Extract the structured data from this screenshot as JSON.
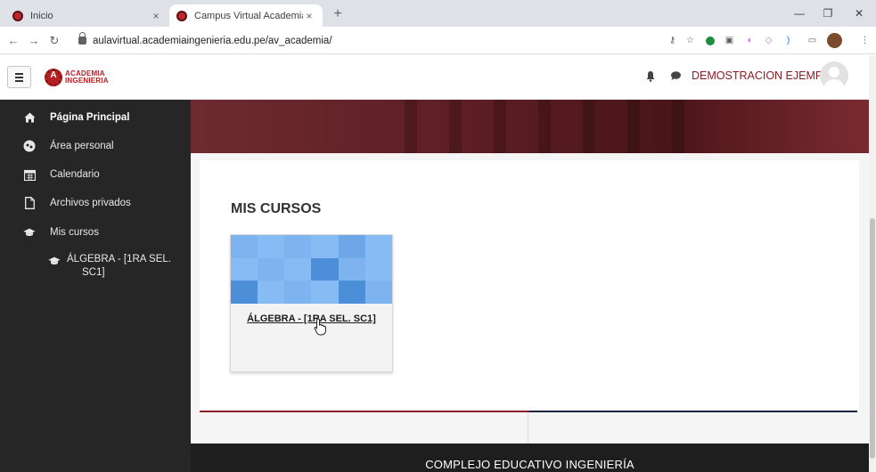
{
  "browser": {
    "tabs": [
      {
        "title": "Inicio",
        "active": false
      },
      {
        "title": "Campus Virtual Academia Ingeni",
        "active": true
      }
    ],
    "url": "aulavirtual.academiaingenieria.edu.pe/av_academia/",
    "close_symbol": "×",
    "new_tab_symbol": "+"
  },
  "header": {
    "logo_line1": "ACADEMIA",
    "logo_line2": "INGENIERIA",
    "user_name": "DEMOSTRACION EJEMPLO",
    "icons": [
      "bell-icon",
      "chat-icon",
      "avatar"
    ]
  },
  "sidebar": {
    "items": [
      {
        "label": "Página Principal",
        "icon": "home-icon",
        "active": true
      },
      {
        "label": "Área personal",
        "icon": "dashboard-icon"
      },
      {
        "label": "Calendario",
        "icon": "calendar-icon"
      },
      {
        "label": "Archivos privados",
        "icon": "file-icon"
      },
      {
        "label": "Mis cursos",
        "icon": "graduation-cap-icon"
      }
    ],
    "course": {
      "line1": "ÁLGEBRA - [1RA SEL.",
      "line2": "SC1]",
      "icon": "graduation-cap-icon"
    }
  },
  "main": {
    "section_title": "MIS CURSOS",
    "courses": [
      {
        "name": "ÁLGEBRA - [1RA SEL. SC1]"
      }
    ]
  },
  "footer": {
    "text": "COMPLEJO EDUCATIVO INGENIERÍA"
  },
  "colors": {
    "brand_red": "#b52025",
    "sidebar_bg": "#262626",
    "user_name": "#8a1d24",
    "divider_red": "#8a1d2c",
    "divider_navy": "#16243e"
  }
}
